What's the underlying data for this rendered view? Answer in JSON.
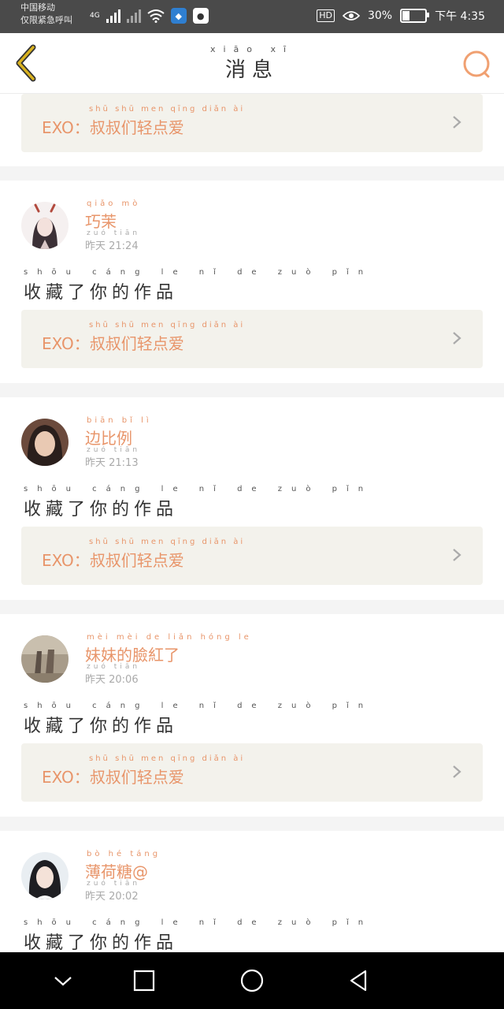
{
  "status_bar": {
    "carrier_line1": "中国移动",
    "carrier_line2": "仅限紧急呼叫",
    "network": "4G",
    "battery": "30%",
    "time": "下午 4:35",
    "hd": "HD"
  },
  "nav": {
    "title": "消息",
    "title_pinyin": "xiāo xī"
  },
  "work_title_prefix": "EXO：",
  "work_title": "叔叔们轻点爱",
  "work_title_pinyin": "shū shū men qīng diǎn ài",
  "action_text": "收藏了你的作品",
  "action_pinyin": "shōu cáng le nǐ de zuò pǐn",
  "items": [
    {
      "name": "巧茉",
      "name_pinyin": "qiǎo mò",
      "time": "昨天 21:24",
      "time_pinyin": "zuó tiān"
    },
    {
      "name": "边比例",
      "name_pinyin": "biān bǐ lì",
      "time": "昨天 21:13",
      "time_pinyin": "zuó tiān"
    },
    {
      "name": "妹妹的臉紅了",
      "name_pinyin": "mèi mèi de liǎn hóng le",
      "time": "昨天 20:06",
      "time_pinyin": "zuó tiān"
    },
    {
      "name": "薄荷糖@",
      "name_pinyin": "bò hé táng",
      "time": "昨天 20:02",
      "time_pinyin": "zuó tiān"
    }
  ],
  "colors": {
    "accent": "#e8956a",
    "back_arrow": "#d9b21f",
    "status_bar": "#4a4a4a"
  }
}
